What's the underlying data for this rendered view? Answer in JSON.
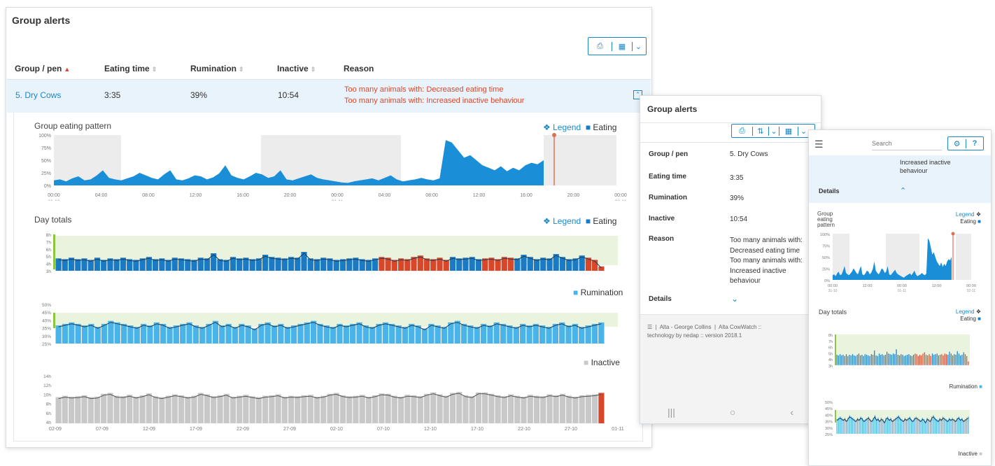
{
  "desktop": {
    "title": "Group alerts",
    "columns": [
      "Group / pen",
      "Eating time",
      "Rumination",
      "Inactive",
      "Reason"
    ],
    "row": {
      "group": "5. Dry Cows",
      "eating_time": "3:35",
      "rumination": "39%",
      "inactive": "10:54",
      "reasons": [
        "Too many animals with: Decreased eating time",
        "Too many animals with: Increased inactive behaviour"
      ]
    },
    "pattern_title": "Group eating pattern",
    "day_totals_title": "Day totals",
    "legend_label": "Legend",
    "eating_label": "Eating",
    "rumination_label": "Rumination",
    "inactive_label": "Inactive",
    "pattern_y_ticks": [
      "100%",
      "75%",
      "50%",
      "25%",
      "0%"
    ],
    "pattern_x_ticks": [
      "00:00",
      "04:00",
      "08:00",
      "12:00",
      "16:00",
      "20:00",
      "00:00",
      "04:00",
      "08:00",
      "12:00",
      "16:00",
      "20:00",
      "00:00"
    ],
    "pattern_x_sub": [
      "31-10",
      "01-11",
      "02-11"
    ],
    "eating_y_ticks": [
      "8h",
      "7h",
      "6h",
      "5h",
      "4h",
      "3h"
    ],
    "rumination_y_ticks": [
      "50%",
      "45%",
      "40%",
      "35%",
      "30%",
      "25%"
    ],
    "inactive_y_ticks": [
      "14h",
      "12h",
      "10h",
      "8h",
      "6h",
      "4h"
    ],
    "date_ticks": [
      "02-09",
      "07-09",
      "12-09",
      "17-09",
      "22-09",
      "27-09",
      "02-10",
      "07-10",
      "12-10",
      "17-10",
      "22-10",
      "27-10",
      "01-11"
    ]
  },
  "tablet": {
    "title": "Group alerts",
    "labels": {
      "group": "Group / pen",
      "eating": "Eating time",
      "rumination": "Rumination",
      "inactive": "Inactive",
      "reason": "Reason",
      "details": "Details"
    },
    "values": {
      "group": "5. Dry Cows",
      "eating": "3:35",
      "rumination": "39%",
      "inactive": "10:54"
    },
    "reason_lines": [
      "Too many animals with:",
      "Decreased eating time",
      "Too many animals with:",
      "Increased inactive",
      "behaviour"
    ],
    "footer": [
      "Alta - George Collins",
      "Alta CowWatch ::",
      "technology by nedap :: version 2018.1"
    ]
  },
  "phone": {
    "search_placeholder": "Search",
    "reason_lines": [
      "Increased inactive",
      "behaviour"
    ],
    "details": "Details",
    "pattern_title_lines": [
      "Group",
      "eating",
      "pattern"
    ],
    "legend_label": "Legend",
    "eating_label": "Eating",
    "day_totals": "Day totals",
    "rumination_label": "Rumination",
    "inactive_label": "Inactive",
    "pattern_y_ticks": [
      "100%",
      "75%",
      "50%",
      "25%",
      "0%"
    ],
    "pattern_x_ticks": [
      "00:00",
      "12:00",
      "00:00",
      "12:00",
      "00:00"
    ],
    "pattern_x_sub": [
      "31-10",
      "01-11",
      "02-11"
    ],
    "eating_y_ticks": [
      "8h",
      "7h",
      "6h",
      "5h",
      "4h",
      "3h"
    ],
    "rumination_y_ticks": [
      "50%",
      "45%",
      "40%",
      "35%",
      "30%",
      "25%"
    ]
  },
  "colors": {
    "accent": "#1a88c9",
    "eating": "#1a7ac4",
    "alert": "#d9472b",
    "rumination": "#4ab3e8",
    "inactive": "#c8c8c8"
  },
  "chart_data": [
    {
      "type": "area",
      "title": "Group eating pattern",
      "ylim": [
        0,
        100
      ],
      "x_range": [
        "31-10 00:00",
        "02-11 00:00"
      ],
      "series": [
        {
          "name": "Eating",
          "values": [
            10,
            12,
            8,
            14,
            18,
            10,
            12,
            20,
            30,
            15,
            12,
            10,
            14,
            18,
            25,
            20,
            15,
            12,
            22,
            30,
            12,
            10,
            14,
            20,
            18,
            12,
            16,
            24,
            40,
            20,
            15,
            12,
            18,
            25,
            22,
            15,
            18,
            30,
            12,
            10,
            14,
            18,
            22,
            15,
            12,
            10,
            8,
            6,
            5,
            8,
            10,
            12,
            14,
            10,
            15,
            20,
            12,
            8,
            10,
            12,
            15,
            12,
            10,
            14,
            90,
            85,
            70,
            55,
            60,
            50,
            40,
            35,
            30,
            38,
            28,
            35,
            30,
            40,
            45,
            42,
            50
          ]
        }
      ]
    },
    {
      "type": "bar",
      "title": "Day totals",
      "series": [
        {
          "name": "Eating",
          "values": [
            4.7,
            4.6,
            4.8,
            4.6,
            4.7,
            4.5,
            4.8,
            4.5,
            4.7,
            4.6,
            4.8,
            4.6,
            4.5,
            4.7,
            4.9,
            4.6,
            4.7,
            4.5,
            4.8,
            4.7,
            4.6,
            4.5,
            4.8,
            4.7,
            5.4,
            4.6,
            4.5,
            4.9,
            4.7,
            4.8,
            4.6,
            4.7,
            5.2,
            4.9,
            4.8,
            4.7,
            4.9,
            4.8,
            5.6,
            4.7,
            4.6,
            4.8,
            4.7,
            4.5,
            4.6,
            4.7,
            4.8,
            4.6,
            4.5,
            4.7,
            4.9,
            4.8,
            4.5,
            4.7,
            4.6,
            4.9,
            5.1,
            4.7,
            4.6,
            4.8,
            4.5,
            4.9,
            4.7,
            4.8,
            4.9,
            4.6,
            4.7,
            4.8,
            4.6,
            4.9,
            4.8,
            4.7,
            5.2,
            4.9,
            4.6,
            4.8,
            4.7,
            5.3,
            4.9,
            4.6,
            4.7,
            5.1,
            4.8,
            4.5,
            3.6
          ]
        }
      ]
    },
    {
      "type": "bar",
      "title": "Rumination",
      "ylim": [
        25,
        50
      ],
      "series": [
        {
          "name": "Rumination",
          "values": [
            37,
            38,
            39,
            38,
            37,
            38,
            36,
            38,
            40,
            39,
            38,
            37,
            36,
            38,
            37,
            39,
            38,
            36,
            37,
            38,
            39,
            37,
            36,
            38,
            40,
            37,
            38,
            36,
            38,
            37,
            35,
            38,
            39,
            37,
            38,
            36,
            37,
            38,
            39,
            40,
            38,
            37,
            36,
            38,
            37,
            38,
            39,
            37,
            36,
            38,
            39,
            38,
            37,
            36,
            38,
            37,
            35,
            38,
            37,
            36,
            39,
            40,
            38,
            37,
            36,
            38,
            37,
            39,
            38,
            37,
            36,
            38,
            37,
            38,
            37,
            36,
            38,
            39,
            37,
            38,
            36,
            37,
            38,
            39
          ]
        }
      ]
    },
    {
      "type": "bar",
      "title": "Inactive",
      "ylim": [
        4,
        14
      ],
      "series": [
        {
          "name": "Inactive",
          "values": [
            9.5,
            9.8,
            9.6,
            9.7,
            9.9,
            9.5,
            9.6,
            10.2,
            10.4,
            9.8,
            9.7,
            10.0,
            9.6,
            9.9,
            10.3,
            9.7,
            9.5,
            9.8,
            10.1,
            9.9,
            9.6,
            9.8,
            10.4,
            10.1,
            9.7,
            9.9,
            10.2,
            9.6,
            9.8,
            10.0,
            9.7,
            9.5,
            9.8,
            9.9,
            10.1,
            9.6,
            9.8,
            9.7,
            9.9,
            10.0,
            9.6,
            9.8,
            10.2,
            10.4,
            9.9,
            9.7,
            9.8,
            10.0,
            9.6,
            9.9,
            10.3,
            10.2,
            9.8,
            9.6,
            10.0,
            9.9,
            9.7,
            10.2,
            10.5,
            10.1,
            9.8,
            10.4,
            10.6,
            9.9,
            9.7,
            10.5,
            10.5,
            10.2,
            9.9,
            9.7,
            10.1,
            9.8,
            9.6,
            10.0,
            9.8,
            9.7,
            10.1,
            9.9,
            10.2,
            9.8,
            9.6,
            9.9,
            10.0,
            10.1,
            10.4
          ]
        }
      ]
    }
  ]
}
